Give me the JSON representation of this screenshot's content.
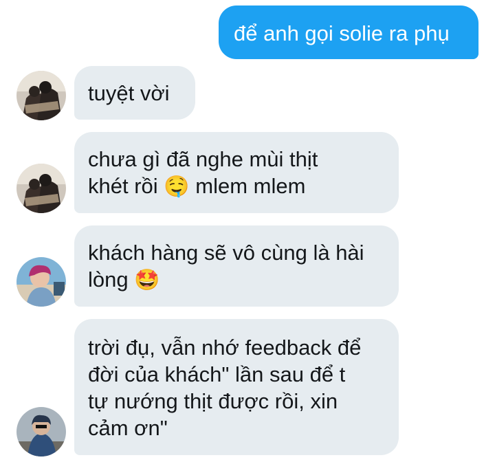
{
  "messages": [
    {
      "id": "m1",
      "direction": "sent",
      "text": "để anh gọi solie ra phụ"
    },
    {
      "id": "m2",
      "direction": "received",
      "avatar": "avatar-1",
      "text": "tuyệt vời"
    },
    {
      "id": "m3",
      "direction": "received",
      "avatar": "avatar-1",
      "lines": [
        "chưa gì đã nghe mùi thịt",
        "khét rồi"
      ],
      "emoji": "drooling-face-emoji",
      "emoji_char": "🤤",
      "after_emoji": "mlem mlem"
    },
    {
      "id": "m4",
      "direction": "received",
      "avatar": "avatar-2",
      "lines": [
        "khách hàng sẽ vô cùng là hài",
        "lòng"
      ],
      "emoji": "star-struck-emoji",
      "emoji_char": "🤩"
    },
    {
      "id": "m5",
      "direction": "received",
      "avatar": "avatar-3",
      "lines": [
        "trời đụ, vẫn nhớ feedback để",
        "đời của khách\" lần sau để t",
        "tự nướng thịt được rồi, xin",
        "cảm ơn\""
      ]
    }
  ],
  "colors": {
    "sent_bubble": "#1da1f2",
    "received_bubble": "#e6ecf0",
    "received_text": "#14171a"
  }
}
